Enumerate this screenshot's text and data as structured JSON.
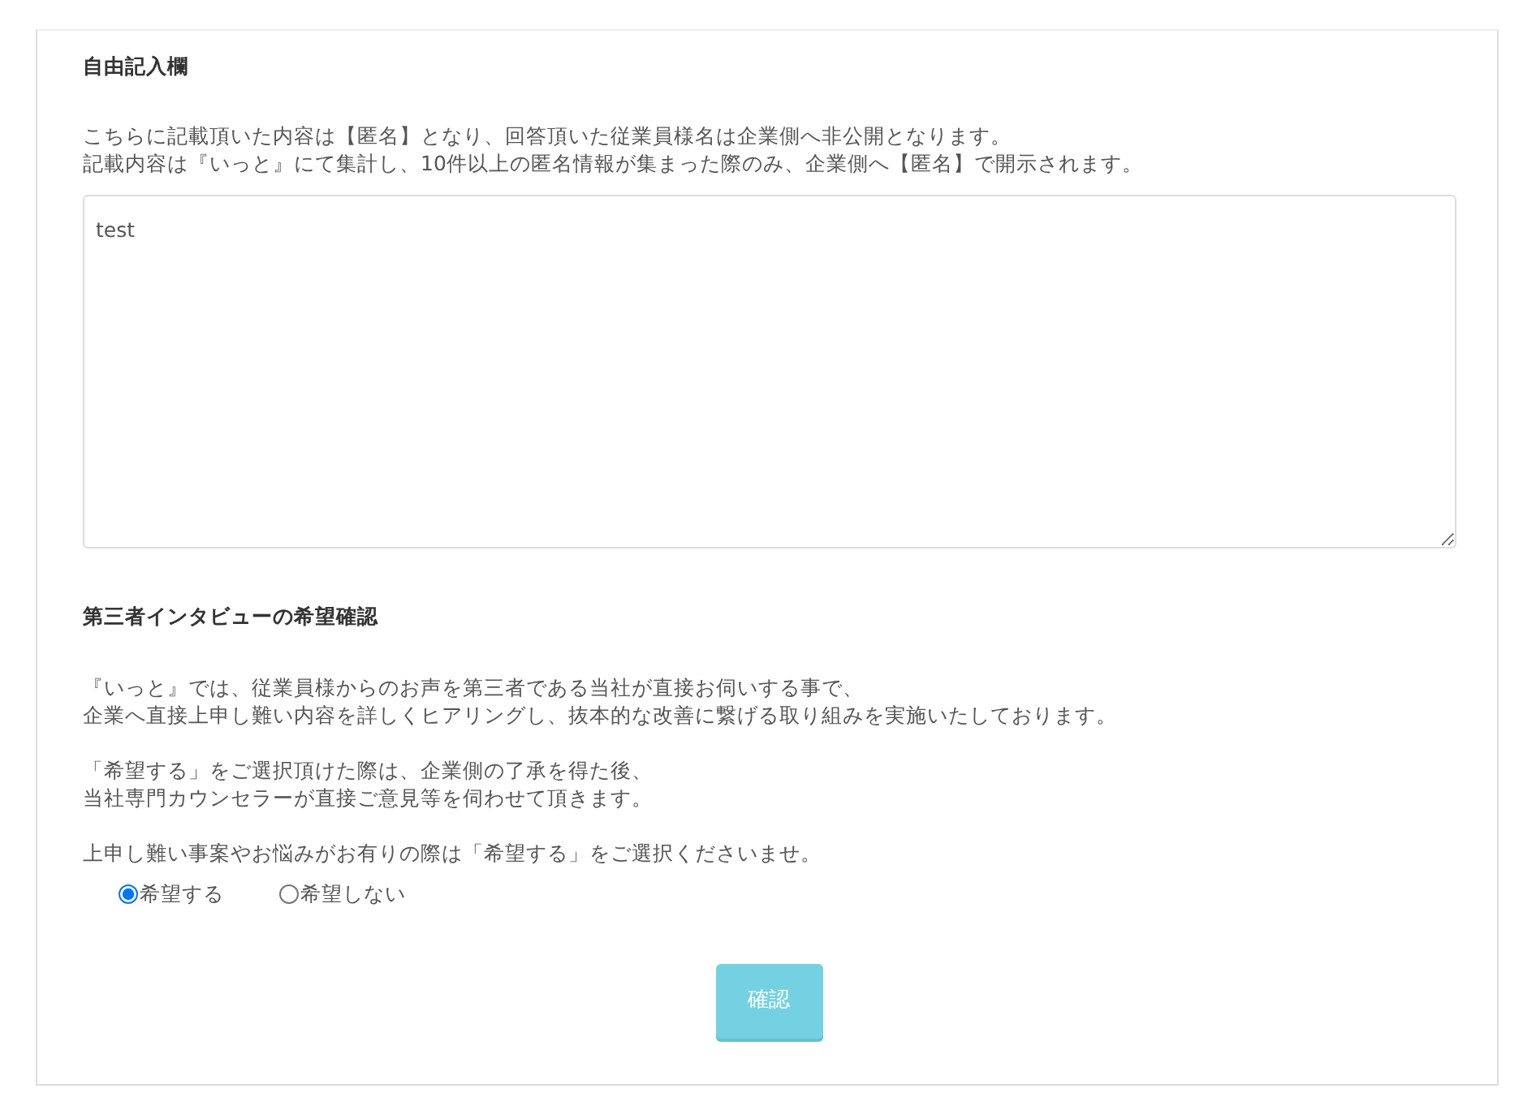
{
  "free_comment": {
    "title": "自由記入欄",
    "paragraphs": [
      [
        "こちらに記載頂いた内容は【匿名】となり、回答頂いた従業員様名は企業側へ非公開となります。",
        "記載内容は『いっと』にて集計し、10件以上の匿名情報が集まった際のみ、企業側へ【匿名】で開示されます。"
      ]
    ],
    "textarea": {
      "value": "test"
    }
  },
  "interview": {
    "title": "第三者インタビューの希望確認",
    "paragraphs": [
      [
        "『いっと』では、従業員様からのお声を第三者である当社が直接お伺いする事で、",
        "企業へ直接上申し難い内容を詳しくヒアリングし、抜本的な改善に繋げる取り組みを実施いたしております。"
      ],
      [
        "「希望する」をご選択頂けた際は、企業側の了承を得た後、",
        "当社専門カウンセラーが直接ご意見等を伺わせて頂きます。"
      ],
      [
        "上申し難い事案やお悩みがお有りの際は「希望する」をご選択くださいませ。"
      ]
    ],
    "options": [
      {
        "label": "希望する",
        "selected": true
      },
      {
        "label": "希望しない",
        "selected": false
      }
    ]
  },
  "submit": {
    "label": "確認",
    "disabled": true
  }
}
